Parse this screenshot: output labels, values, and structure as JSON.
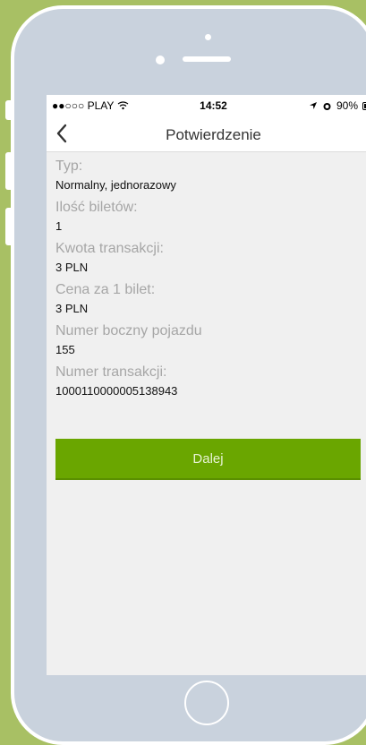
{
  "status_bar": {
    "carrier": "●●○○○ PLAY",
    "time": "14:52",
    "battery_percent": "90%"
  },
  "nav": {
    "title": "Potwierdzenie"
  },
  "fields": [
    {
      "label": "Typ:",
      "value": "Normalny, jednorazowy"
    },
    {
      "label": "Ilość biletów:",
      "value": "1"
    },
    {
      "label": "Kwota transakcji:",
      "value": "3 PLN"
    },
    {
      "label": "Cena za 1 bilet:",
      "value": "3 PLN"
    },
    {
      "label": "Numer boczny pojazdu",
      "value": "155"
    },
    {
      "label": "Numer transakcji:",
      "value": "1000110000005138943"
    }
  ],
  "actions": {
    "next_label": "Dalej"
  },
  "colors": {
    "accent": "#6aa600",
    "background": "#a8c064"
  }
}
